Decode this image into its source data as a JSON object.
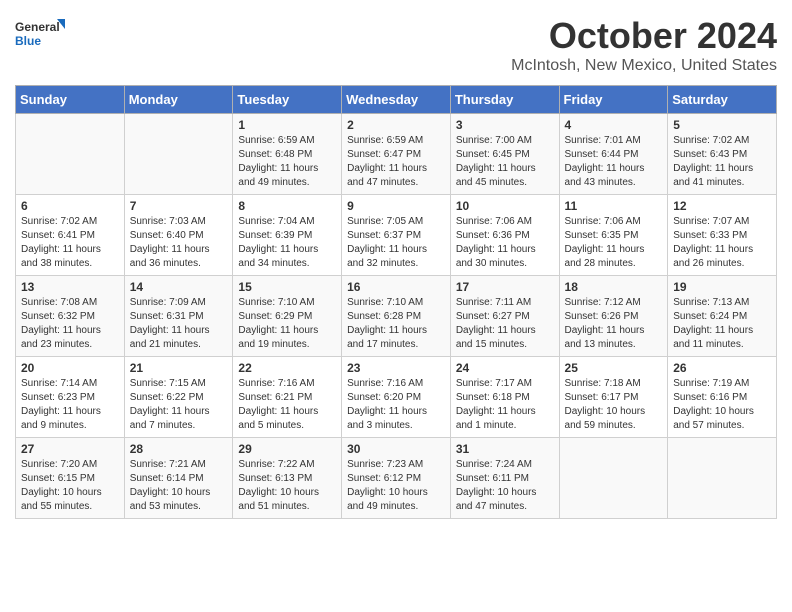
{
  "logo": {
    "line1": "General",
    "line2": "Blue"
  },
  "title": "October 2024",
  "location": "McIntosh, New Mexico, United States",
  "headers": [
    "Sunday",
    "Monday",
    "Tuesday",
    "Wednesday",
    "Thursday",
    "Friday",
    "Saturday"
  ],
  "weeks": [
    [
      {
        "day": "",
        "info": ""
      },
      {
        "day": "",
        "info": ""
      },
      {
        "day": "1",
        "info": "Sunrise: 6:59 AM\nSunset: 6:48 PM\nDaylight: 11 hours and 49 minutes."
      },
      {
        "day": "2",
        "info": "Sunrise: 6:59 AM\nSunset: 6:47 PM\nDaylight: 11 hours and 47 minutes."
      },
      {
        "day": "3",
        "info": "Sunrise: 7:00 AM\nSunset: 6:45 PM\nDaylight: 11 hours and 45 minutes."
      },
      {
        "day": "4",
        "info": "Sunrise: 7:01 AM\nSunset: 6:44 PM\nDaylight: 11 hours and 43 minutes."
      },
      {
        "day": "5",
        "info": "Sunrise: 7:02 AM\nSunset: 6:43 PM\nDaylight: 11 hours and 41 minutes."
      }
    ],
    [
      {
        "day": "6",
        "info": "Sunrise: 7:02 AM\nSunset: 6:41 PM\nDaylight: 11 hours and 38 minutes."
      },
      {
        "day": "7",
        "info": "Sunrise: 7:03 AM\nSunset: 6:40 PM\nDaylight: 11 hours and 36 minutes."
      },
      {
        "day": "8",
        "info": "Sunrise: 7:04 AM\nSunset: 6:39 PM\nDaylight: 11 hours and 34 minutes."
      },
      {
        "day": "9",
        "info": "Sunrise: 7:05 AM\nSunset: 6:37 PM\nDaylight: 11 hours and 32 minutes."
      },
      {
        "day": "10",
        "info": "Sunrise: 7:06 AM\nSunset: 6:36 PM\nDaylight: 11 hours and 30 minutes."
      },
      {
        "day": "11",
        "info": "Sunrise: 7:06 AM\nSunset: 6:35 PM\nDaylight: 11 hours and 28 minutes."
      },
      {
        "day": "12",
        "info": "Sunrise: 7:07 AM\nSunset: 6:33 PM\nDaylight: 11 hours and 26 minutes."
      }
    ],
    [
      {
        "day": "13",
        "info": "Sunrise: 7:08 AM\nSunset: 6:32 PM\nDaylight: 11 hours and 23 minutes."
      },
      {
        "day": "14",
        "info": "Sunrise: 7:09 AM\nSunset: 6:31 PM\nDaylight: 11 hours and 21 minutes."
      },
      {
        "day": "15",
        "info": "Sunrise: 7:10 AM\nSunset: 6:29 PM\nDaylight: 11 hours and 19 minutes."
      },
      {
        "day": "16",
        "info": "Sunrise: 7:10 AM\nSunset: 6:28 PM\nDaylight: 11 hours and 17 minutes."
      },
      {
        "day": "17",
        "info": "Sunrise: 7:11 AM\nSunset: 6:27 PM\nDaylight: 11 hours and 15 minutes."
      },
      {
        "day": "18",
        "info": "Sunrise: 7:12 AM\nSunset: 6:26 PM\nDaylight: 11 hours and 13 minutes."
      },
      {
        "day": "19",
        "info": "Sunrise: 7:13 AM\nSunset: 6:24 PM\nDaylight: 11 hours and 11 minutes."
      }
    ],
    [
      {
        "day": "20",
        "info": "Sunrise: 7:14 AM\nSunset: 6:23 PM\nDaylight: 11 hours and 9 minutes."
      },
      {
        "day": "21",
        "info": "Sunrise: 7:15 AM\nSunset: 6:22 PM\nDaylight: 11 hours and 7 minutes."
      },
      {
        "day": "22",
        "info": "Sunrise: 7:16 AM\nSunset: 6:21 PM\nDaylight: 11 hours and 5 minutes."
      },
      {
        "day": "23",
        "info": "Sunrise: 7:16 AM\nSunset: 6:20 PM\nDaylight: 11 hours and 3 minutes."
      },
      {
        "day": "24",
        "info": "Sunrise: 7:17 AM\nSunset: 6:18 PM\nDaylight: 11 hours and 1 minute."
      },
      {
        "day": "25",
        "info": "Sunrise: 7:18 AM\nSunset: 6:17 PM\nDaylight: 10 hours and 59 minutes."
      },
      {
        "day": "26",
        "info": "Sunrise: 7:19 AM\nSunset: 6:16 PM\nDaylight: 10 hours and 57 minutes."
      }
    ],
    [
      {
        "day": "27",
        "info": "Sunrise: 7:20 AM\nSunset: 6:15 PM\nDaylight: 10 hours and 55 minutes."
      },
      {
        "day": "28",
        "info": "Sunrise: 7:21 AM\nSunset: 6:14 PM\nDaylight: 10 hours and 53 minutes."
      },
      {
        "day": "29",
        "info": "Sunrise: 7:22 AM\nSunset: 6:13 PM\nDaylight: 10 hours and 51 minutes."
      },
      {
        "day": "30",
        "info": "Sunrise: 7:23 AM\nSunset: 6:12 PM\nDaylight: 10 hours and 49 minutes."
      },
      {
        "day": "31",
        "info": "Sunrise: 7:24 AM\nSunset: 6:11 PM\nDaylight: 10 hours and 47 minutes."
      },
      {
        "day": "",
        "info": ""
      },
      {
        "day": "",
        "info": ""
      }
    ]
  ]
}
